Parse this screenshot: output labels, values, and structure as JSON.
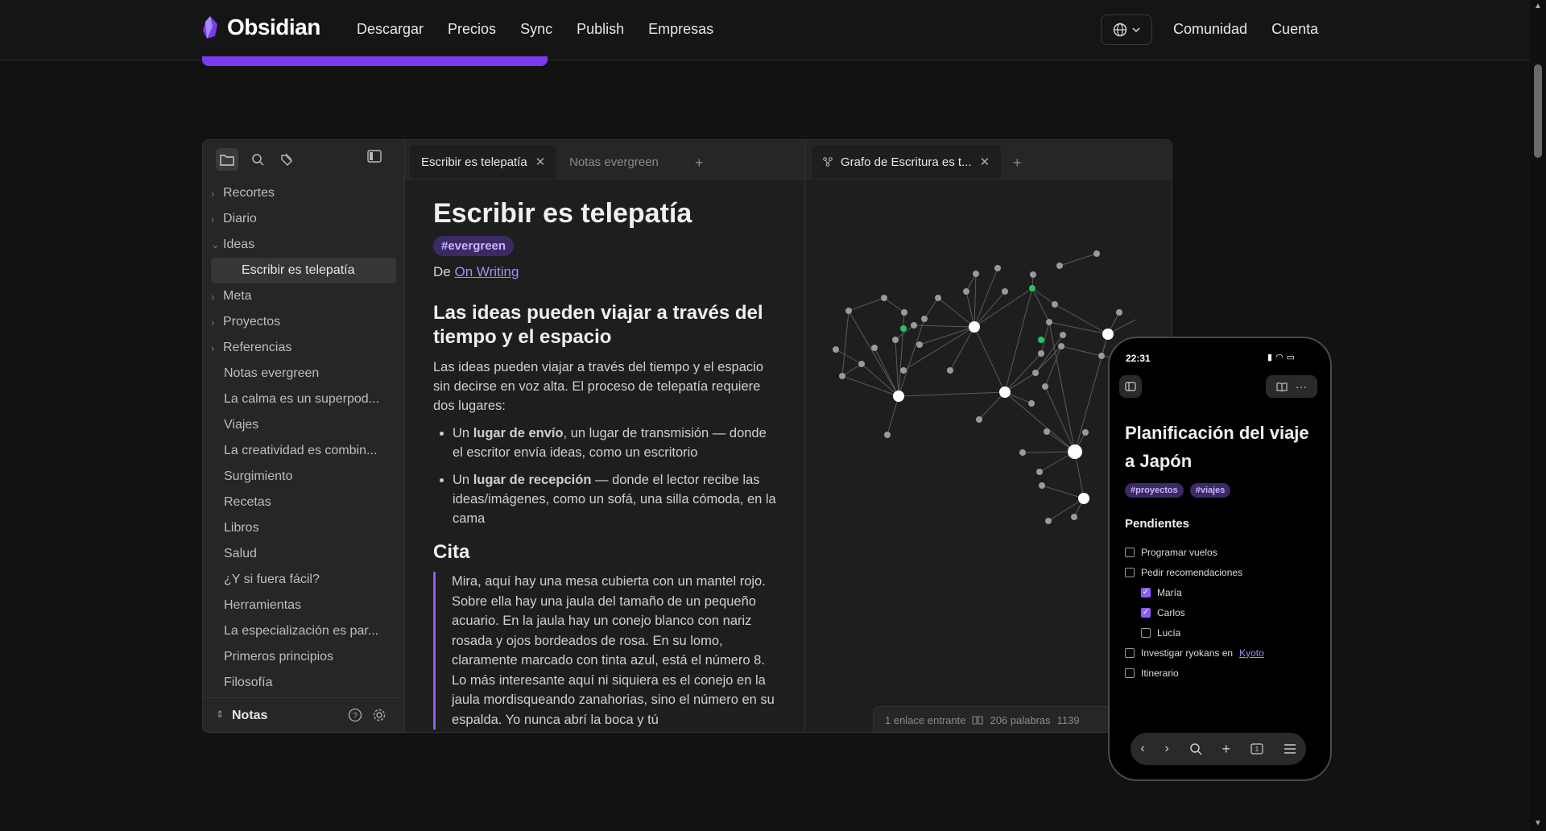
{
  "nav": {
    "brand": "Obsidian",
    "links": [
      "Descargar",
      "Precios",
      "Sync",
      "Publish",
      "Empresas"
    ],
    "right_links": [
      "Comunidad",
      "Cuenta"
    ],
    "accent": "#7c3aed"
  },
  "sidebar": {
    "items": [
      {
        "label": "Recortes",
        "type": "folder"
      },
      {
        "label": "Diario",
        "type": "folder"
      },
      {
        "label": "Ideas",
        "type": "folder-open"
      },
      {
        "label": "Escribir es telepatía",
        "type": "child-selected"
      },
      {
        "label": "Meta",
        "type": "folder"
      },
      {
        "label": "Proyectos",
        "type": "folder"
      },
      {
        "label": "Referencias",
        "type": "folder"
      },
      {
        "label": "Notas evergreen",
        "type": "file"
      },
      {
        "label": "La calma es un superpod...",
        "type": "file"
      },
      {
        "label": "Viajes",
        "type": "file"
      },
      {
        "label": "La creatividad es combin...",
        "type": "file"
      },
      {
        "label": "Surgimiento",
        "type": "file"
      },
      {
        "label": "Recetas",
        "type": "file"
      },
      {
        "label": "Libros",
        "type": "file"
      },
      {
        "label": "Salud",
        "type": "file"
      },
      {
        "label": "¿Y si fuera fácil?",
        "type": "file"
      },
      {
        "label": "Herramientas",
        "type": "file"
      },
      {
        "label": "La especialización es par...",
        "type": "file"
      },
      {
        "label": "Primeros principios",
        "type": "file"
      },
      {
        "label": "Filosofía",
        "type": "file"
      }
    ],
    "vault": "Notas"
  },
  "editor": {
    "tabs": [
      "Escribir es telepatía",
      "Notas evergreen"
    ],
    "title": "Escribir es telepatía",
    "tag": "#evergreen",
    "from_prefix": "De",
    "from_link": "On Writing",
    "h2": "Las ideas pueden viajar a través del tiempo y el espacio",
    "para": "Las ideas pueden viajar a través del tiempo y el espacio sin decirse en voz alta. El proceso de telepatía requiere dos lugares:",
    "bullet1_pre": "Un",
    "bullet1_bold": "lugar de envío",
    "bullet1_post": ", un lugar de transmisión — donde el escritor envía ideas, como un escritorio",
    "bullet2_pre": "Un",
    "bullet2_bold": "lugar de recepción",
    "bullet2_post": " — donde el lector recibe las ideas/imágenes, como un sofá, una silla cómoda, en la cama",
    "h2b": "Cita",
    "quote": "Mira, aquí hay una mesa cubierta con un mantel rojo. Sobre ella hay una jaula del tamaño de un pequeño acuario. En la jaula hay un conejo blanco con nariz rosada y ojos bordeados de rosa. En su lomo, claramente marcado con tinta azul, está el número 8. Lo más interesante aquí ni siquiera es el conejo en la jaula mordisqueando zanahorias, sino el número en su espalda. Yo nunca abrí la boca y tú"
  },
  "graph": {
    "tab": "Grafo de Escritura es t...",
    "status": {
      "backlinks": "1 enlace entrante",
      "words": "206 palabras",
      "chars": "1139"
    }
  },
  "phone": {
    "time": "22:31",
    "title": "Planificación del viaje a Japón",
    "tags": [
      "#proyectos",
      "#viajes"
    ],
    "heading": "Pendientes",
    "tasks": [
      {
        "label": "Programar vuelos",
        "checked": false,
        "sub": false
      },
      {
        "label": "Pedir recomendaciones",
        "checked": false,
        "sub": false
      },
      {
        "label": "María",
        "checked": true,
        "sub": true
      },
      {
        "label": "Carlos",
        "checked": true,
        "sub": true
      },
      {
        "label": "Lucía",
        "checked": false,
        "sub": true
      },
      {
        "label": "Investigar ryokans en",
        "link": "Kyoto",
        "checked": false,
        "sub": false
      },
      {
        "label": "Itinerario",
        "checked": false,
        "sub": false
      }
    ]
  }
}
